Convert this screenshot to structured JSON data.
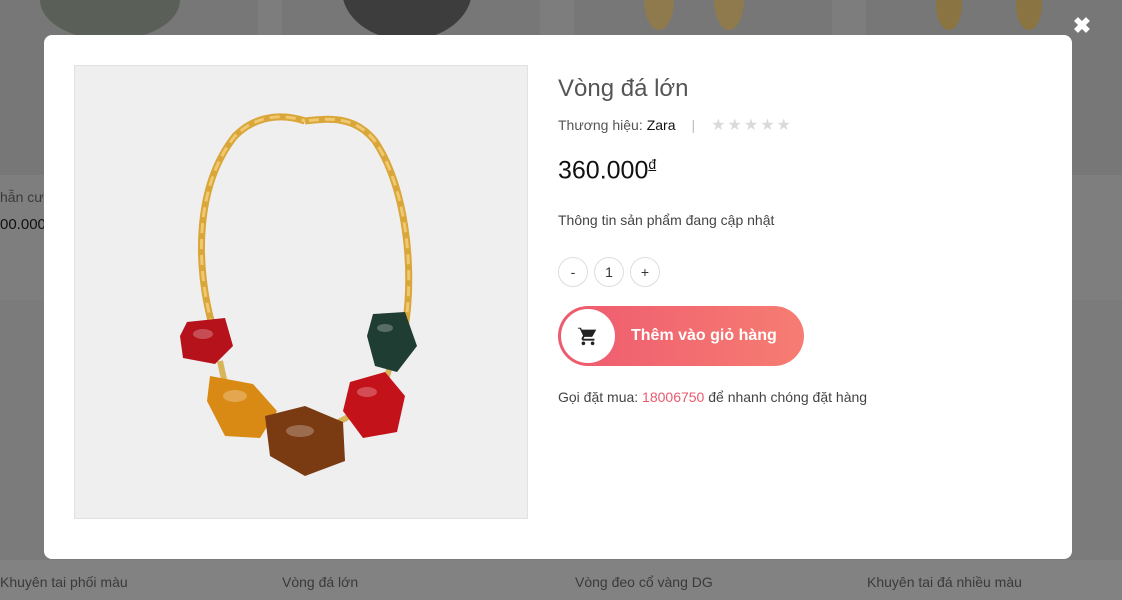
{
  "background": {
    "product_titles": [
      "Khuyên tai phối màu",
      "Vòng đá lớn",
      "Vòng đeo cổ vàng DG",
      "Khuyên tai đá nhiều màu"
    ],
    "partial_title": "hẫn cư",
    "partial_price": "00.000"
  },
  "close": {
    "glyph": "✖"
  },
  "product": {
    "title": "Vòng đá lớn",
    "brand_label": "Thương hiệu:",
    "brand": "Zara",
    "separator": "|",
    "rating": 0,
    "price": "360.000",
    "currency": "đ",
    "description": "Thông tin sản phẩm đang cập nhật",
    "image_alt": "Red, green and amber stone necklace with gold chain"
  },
  "quantity": {
    "minus": "-",
    "value": "1",
    "plus": "+"
  },
  "cart_button": {
    "label": "Thêm vào giỏ hàng",
    "icon": "cart-icon"
  },
  "call": {
    "prefix": "Gọi đặt mua:",
    "phone": "18006750",
    "suffix": "để nhanh chóng đặt hàng"
  },
  "colors": {
    "accent": "#ee5a6e",
    "accent_end": "#f67d73",
    "phone": "#e85a6e"
  }
}
